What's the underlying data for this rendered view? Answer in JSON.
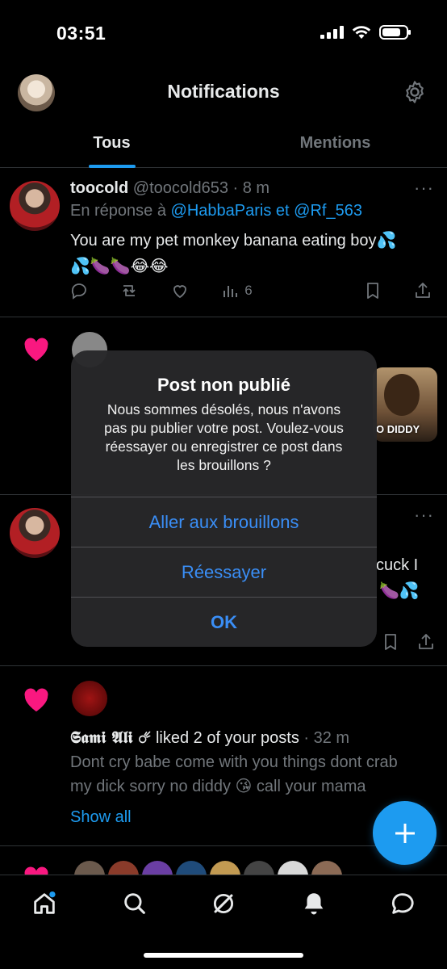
{
  "status_bar": {
    "time": "03:51"
  },
  "header": {
    "title": "Notifications"
  },
  "tabs": [
    {
      "label": "Tous",
      "active": true
    },
    {
      "label": "Mentions",
      "active": false
    }
  ],
  "post1": {
    "name": "toocold",
    "handle": "@toocold653",
    "time": "8 m",
    "reply_prefix": "En réponse à",
    "reply_to": "@HabbaParis et @Rf_563",
    "text_line1": "You are my pet monkey banana eating boy💦",
    "text_line2": "💦🍆🍆😂😂",
    "views": "6"
  },
  "post2_visible": {
    "tail_text": "O DIDDY"
  },
  "post3_visible": {
    "text_right": "cuck I",
    "emoji_right": "🍆💦"
  },
  "like_notif": {
    "name": "𝕾𝖆𝖒𝖎 𝕬𝖑𝖎 ☄",
    "action": "liked 2 of your posts",
    "time": "32 m",
    "text_line1": "Dont cry babe come with you things dont crab",
    "text_line2": "my dick sorry no diddy 😘 call your mama",
    "show_all": "Show all"
  },
  "dialog": {
    "title": "Post non publié",
    "message_line1": "Nous sommes désolés, nous n'avons",
    "message_line2": "pas pu publier votre post. Voulez-vous",
    "message_line3": "réessayer ou enregistrer ce post dans",
    "message_line4": "les brouillons ?",
    "btn_drafts": "Aller aux brouillons",
    "btn_retry": "Réessayer",
    "btn_ok": "OK"
  },
  "colors": {
    "accent": "#1d9bf0",
    "heart": "#f91880",
    "dialog_button": "#3a8ef6"
  }
}
